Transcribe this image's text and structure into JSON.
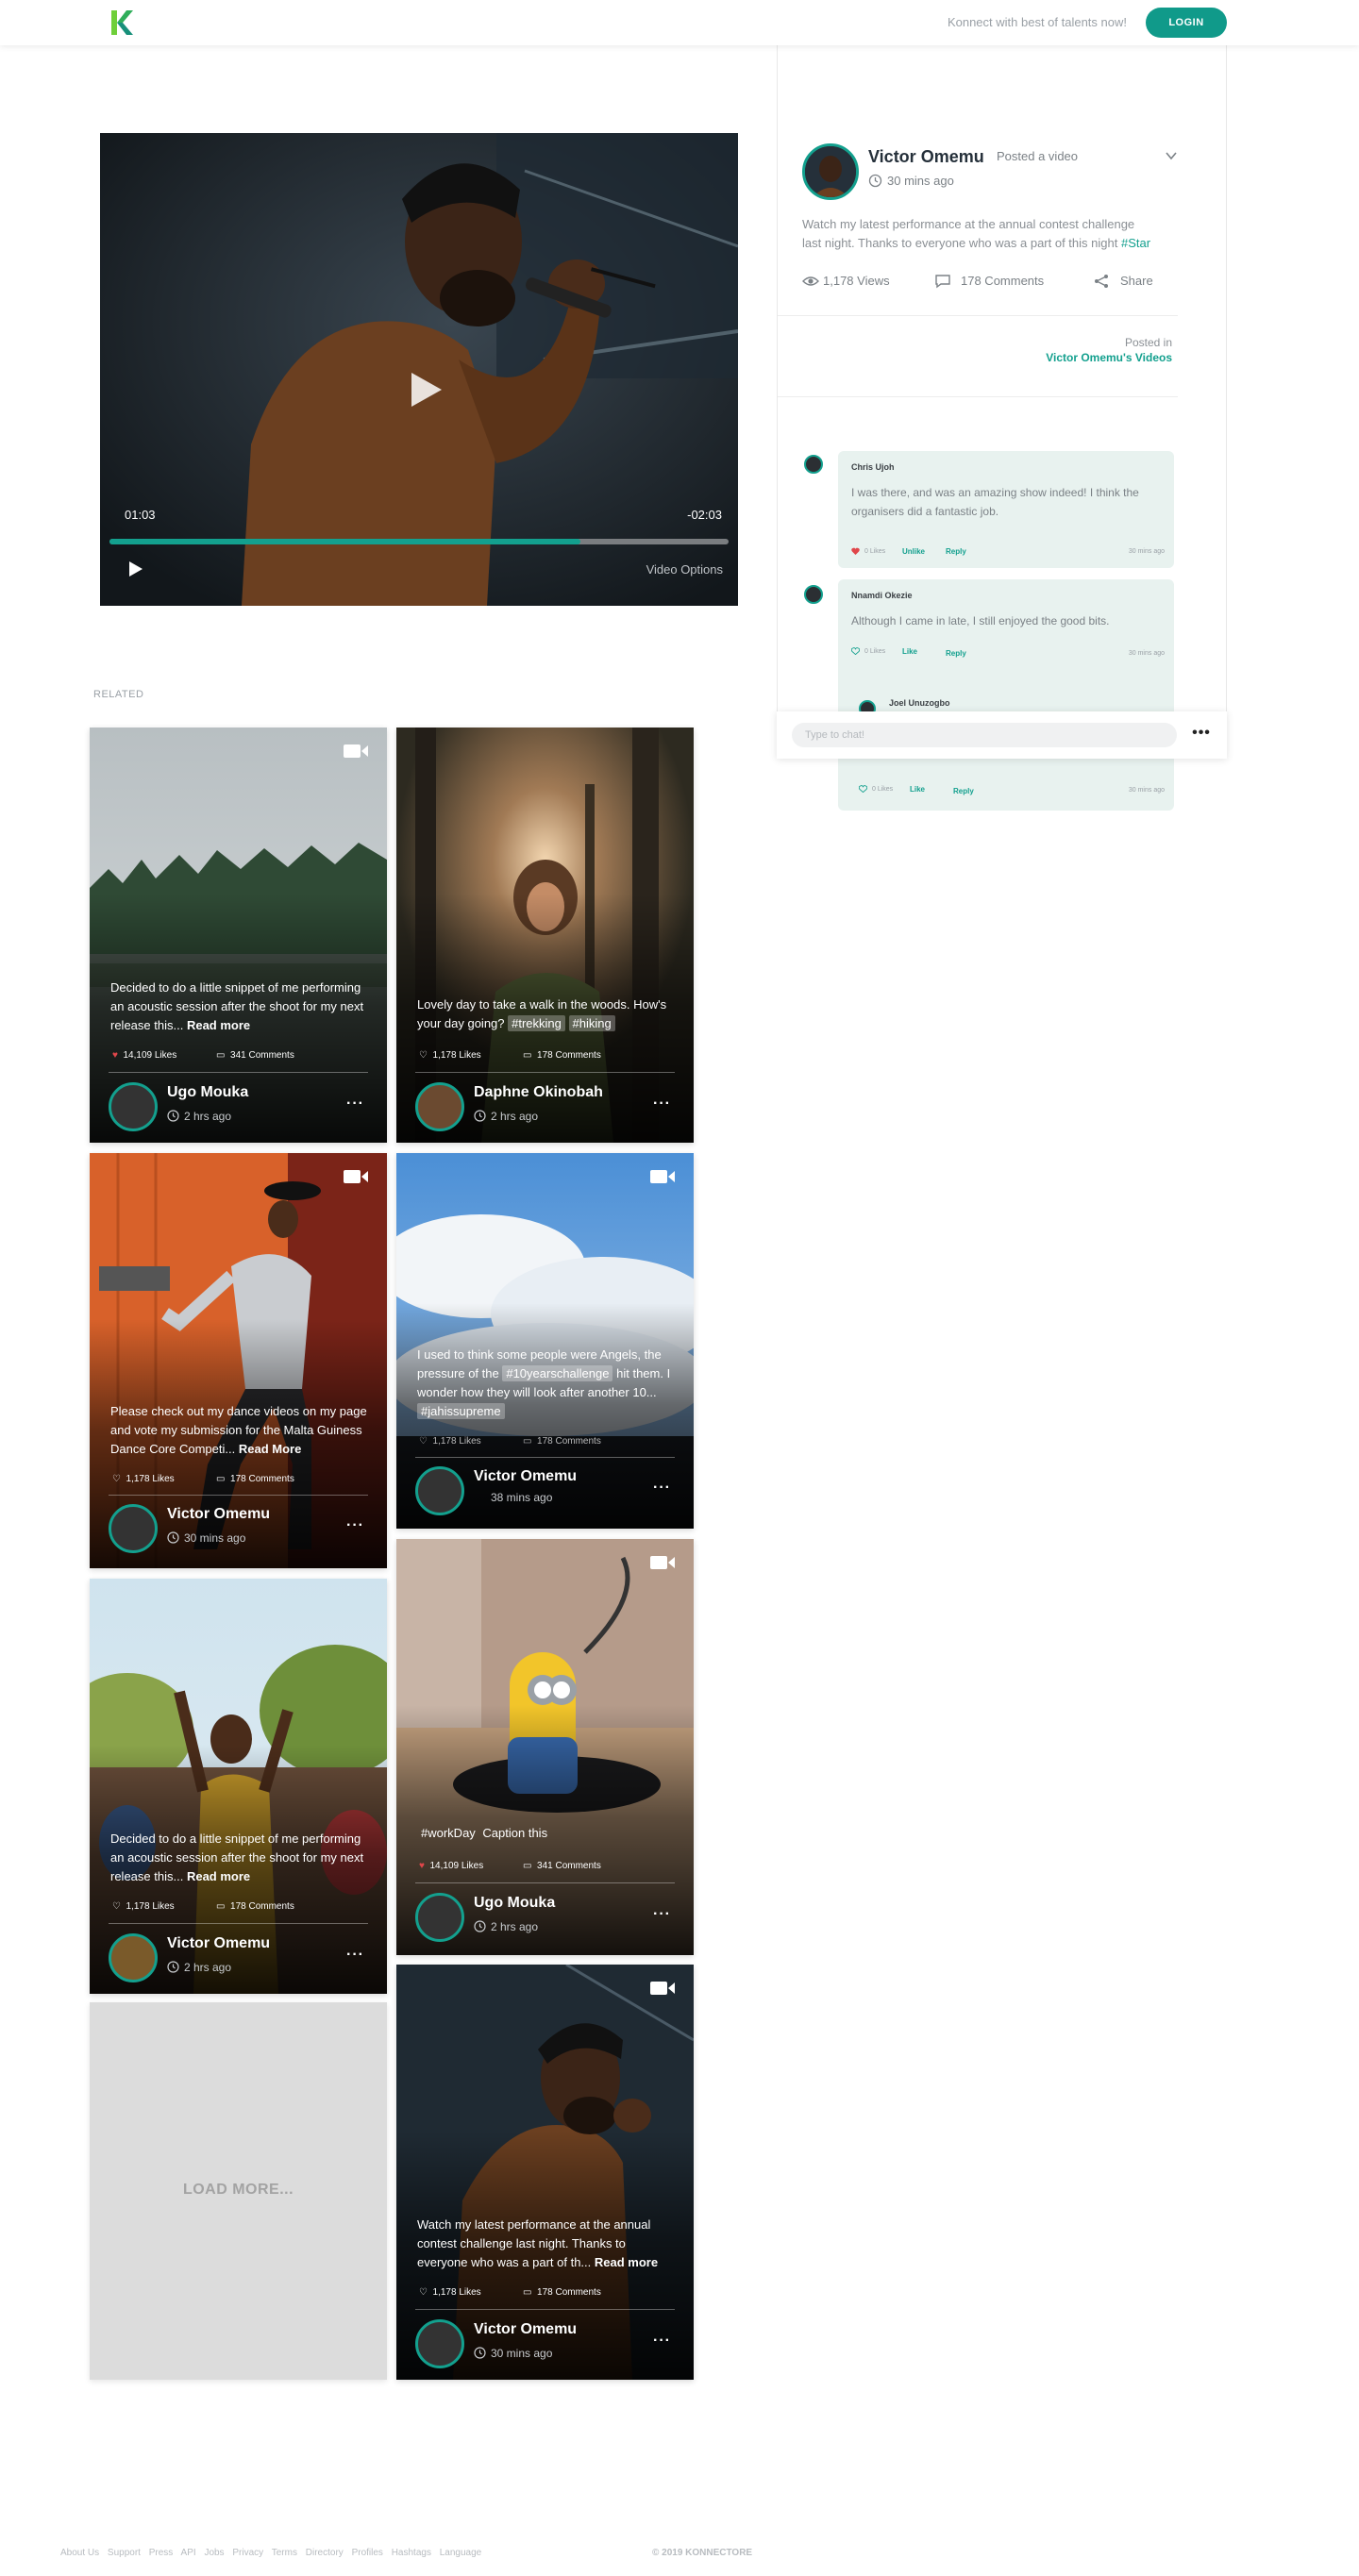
{
  "header": {
    "tagline": "Konnect with best of talents now!",
    "login_label": "LOGIN",
    "brand_color": "#109a8a"
  },
  "video": {
    "time_elapsed": "01:03",
    "time_remaining": "-02:03",
    "options_label": "Video Options",
    "progress_fraction": 0.76
  },
  "post": {
    "author": "Victor Omemu",
    "action": "Posted a video",
    "time": "30 mins ago",
    "text_line1": "Watch my latest performance at the annual contest challenge",
    "text_line2": "last night. Thanks to everyone who was a part of this night",
    "hashtag": "#Star",
    "views": "1,178 Views",
    "comments": "178 Comments",
    "share": "Share",
    "posted_in_label": "Posted in",
    "posted_in_link": "Victor Omemu's Videos"
  },
  "comments": [
    {
      "name": "Chris Ujoh",
      "text": "I was there, and was an amazing show indeed! I think the organisers did a fantastic job.",
      "likes": "0 Likes",
      "like_action": "Unlike",
      "reply": "Reply",
      "time": "30 mins ago"
    },
    {
      "name": "Nnamdi Okezie",
      "text": "Although I came in late, I still enjoyed the good bits.",
      "likes": "0 Likes",
      "like_action": "Like",
      "reply": "Reply",
      "time": "30 mins ago"
    },
    {
      "name": "Joel Unuzogbo",
      "likes": "0 Likes",
      "like_action": "Like",
      "reply": "Reply",
      "time": "30 mins ago"
    }
  ],
  "chat": {
    "placeholder": "Type to chat!",
    "more": "•••"
  },
  "related": {
    "label": "RELATED",
    "load_more": "LOAD MORE...",
    "cards": [
      {
        "caption_pre": "Decided to do a little snippet of me performing an acoustic session after the shoot for my next release this...",
        "read_more": "Read more",
        "likes": "14,109 Likes",
        "comments": "341 Comments",
        "user": "Ugo Mouka",
        "time": "2 hrs ago"
      },
      {
        "caption_pre": "Lovely day to take a walk in the woods. How's your day going?",
        "tag1": "#trekking",
        "tag2": "#hiking",
        "likes": "1,178 Likes",
        "comments": "178 Comments",
        "user": "Daphne Okinobah",
        "time": "2 hrs ago"
      },
      {
        "caption_pre": "Please check out my dance videos on my page and vote my submission for the Malta Guiness Dance Core Competi...",
        "read_more": "Read More",
        "likes": "1,178 Likes",
        "comments": "178 Comments",
        "user": "Victor Omemu",
        "time": "30 mins ago"
      },
      {
        "caption_pre": "I used to think some people were Angels,",
        "caption_mid": "the pressure of the",
        "tag1": "#10yearschallenge",
        "caption_post": "hit them. I wonder how they will look after another 10...",
        "tag2": "#jahissupreme",
        "likes": "1,178 Likes",
        "comments": "178 Comments",
        "user": "Victor Omemu",
        "time": "38 mins ago"
      },
      {
        "caption_pre": "Decided to do a little snippet of me performing an acoustic session after the shoot for my next release this...",
        "read_more": "Read more",
        "likes": "1,178 Likes",
        "comments": "178 Comments",
        "user": "Victor Omemu",
        "time": "2 hrs ago"
      },
      {
        "caption_pre": "#workDay",
        "caption_post": "Caption this",
        "likes": "14,109 Likes",
        "comments": "341 Comments",
        "user": "Ugo Mouka",
        "time": "2 hrs ago"
      },
      {
        "caption_pre": "Watch my latest performance at the annual contest challenge last night. Thanks to everyone who was a part of th...",
        "read_more": "Read more",
        "likes": "1,178 Likes",
        "comments": "178 Comments",
        "user": "Victor Omemu",
        "time": "30 mins ago"
      }
    ]
  },
  "footer": {
    "links": [
      "About Us",
      "Support",
      "Press",
      "API",
      "Jobs",
      "Privacy",
      "Terms",
      "Directory",
      "Profiles",
      "Hashtags",
      "Language"
    ],
    "copyright": "© 2019 KONNECTORE"
  }
}
